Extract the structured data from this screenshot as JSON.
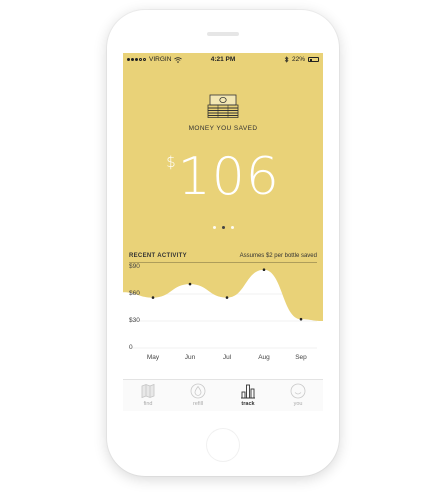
{
  "status_bar": {
    "carrier": "VIRGIN",
    "time": "4:21 PM",
    "battery": "22%",
    "battery_level": 0.22
  },
  "hero": {
    "icon": "money-stack-icon",
    "title": "MONEY YOU SAVED",
    "currency": "$",
    "amount": "106",
    "pages": 3,
    "active_page": 2
  },
  "activity": {
    "title": "RECENT ACTIVITY",
    "note": "Assumes $2 per bottle saved"
  },
  "chart_data": {
    "type": "area",
    "categories": [
      "May",
      "Jun",
      "Jul",
      "Aug",
      "Sep"
    ],
    "x": [
      0.1,
      0.2,
      0.3,
      0.4,
      0.5
    ],
    "series": [
      {
        "values": [
          {
            "month": "May",
            "value": 56
          },
          {
            "month": "Jun",
            "value": 71
          },
          {
            "month": "Jul",
            "value": 56
          },
          {
            "month": "Aug",
            "value": 87
          },
          {
            "month": "Sep",
            "value": 32
          }
        ]
      }
    ],
    "y_ticks": [
      "$90",
      "$60",
      "$30",
      "0"
    ],
    "ylim": [
      0,
      90
    ],
    "grid": true,
    "colors": {
      "fill": "#e9d278",
      "line": "#e0c45c",
      "marker": "#222222",
      "grid": "#e2e2e2"
    }
  },
  "tabbar": {
    "tabs": [
      {
        "label": "find",
        "icon": "map-icon",
        "active": false
      },
      {
        "label": "refill",
        "icon": "drop-icon",
        "active": false
      },
      {
        "label": "track",
        "icon": "bar-chart-icon",
        "active": true
      },
      {
        "label": "you",
        "icon": "face-icon",
        "active": false
      }
    ]
  },
  "colors": {
    "accent": "#e9d278",
    "text": "#333333",
    "inactive": "#aaaaaa"
  }
}
